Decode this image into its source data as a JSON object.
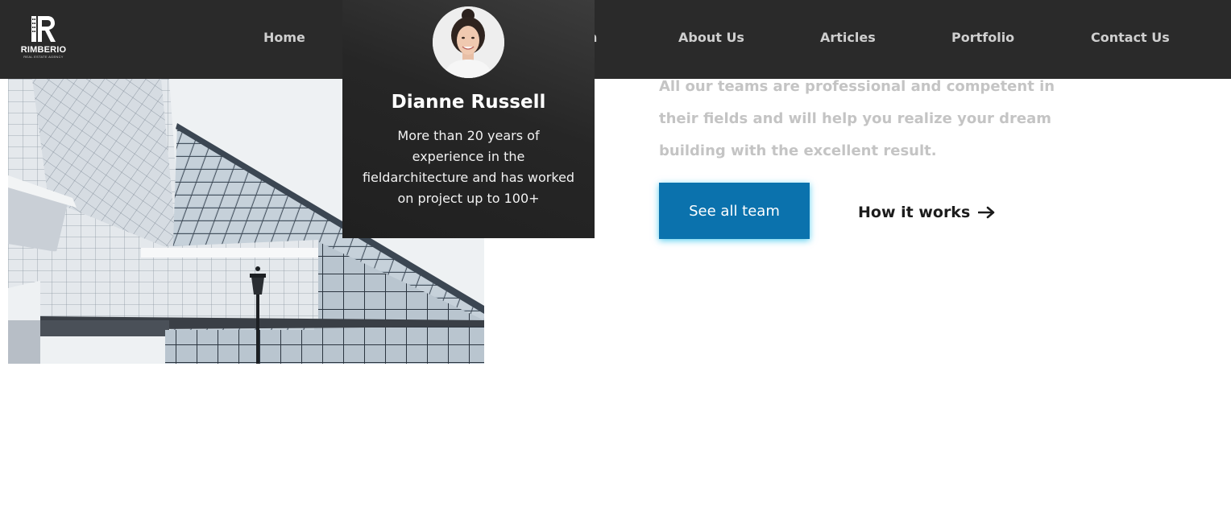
{
  "brand": {
    "name": "RIMBERIO",
    "tagline": "REAL ESTATE AGENCY",
    "logo_icon": "building-r-logo"
  },
  "nav": {
    "items": [
      {
        "label": "Home"
      },
      {
        "label": "n"
      },
      {
        "label": "About Us"
      },
      {
        "label": "Articles"
      },
      {
        "label": "Portfolio"
      },
      {
        "label": "Contact Us"
      }
    ]
  },
  "team_card": {
    "name": "Dianne Russell",
    "bio": "More than 20 years of experience in the fieldarchitecture and has worked on project up to 100+"
  },
  "content": {
    "description": "All our teams are professional and competent in their fields and will help you realize your dream building with the excellent result.",
    "primary_button": "See all team",
    "secondary_link": "How it works",
    "secondary_icon": "arrow-right-icon"
  },
  "colors": {
    "header_bg": "#2a2a2a",
    "accent": "#0b72ad",
    "muted_text": "#c4c4c4"
  }
}
